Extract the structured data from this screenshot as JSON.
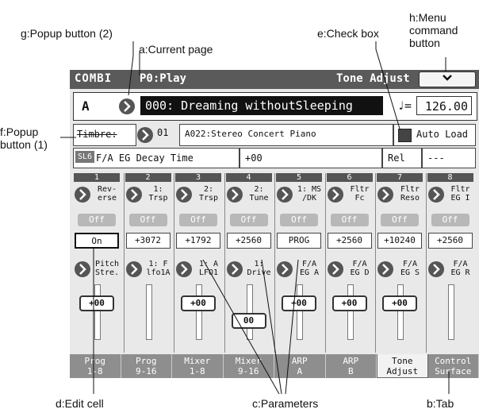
{
  "annotations": {
    "g": "g:Popup button (2)",
    "a": "a:Current page",
    "e": "e:Check box",
    "h_line1": "h:Menu",
    "h_line2": "command",
    "h_line3": "button",
    "f_line1": "f:Popup",
    "f_line2": "button (1)",
    "d": "d:Edit cell",
    "c": "c:Parameters",
    "b": "b:Tab"
  },
  "titlebar": {
    "mode": "COMBI",
    "page": "P0:Play",
    "subpage": "Tone Adjust",
    "menu_icon": "chevron-down-icon",
    "menu_glyph": "⌄"
  },
  "program": {
    "bank": "A",
    "name": "000: Dreaming withoutSleeping",
    "tempo_symbol": "♩=",
    "tempo": "126.00"
  },
  "timbre": {
    "label": "Timbre:",
    "number": "01",
    "program": "A022:Stereo Concert Piano",
    "autoload_label": "Auto Load"
  },
  "param": {
    "slot": "SL6",
    "name": "F/A EG Decay Time",
    "value": "+00",
    "rel_label": "Rel",
    "rel_value": "---"
  },
  "channels": [
    {
      "num": "1",
      "name1": "Rev-\nerse",
      "off": "Off",
      "value": "On",
      "name2": "Pitch\nStre.",
      "knob": "+00"
    },
    {
      "num": "2",
      "name1": "1:\nTrsp",
      "off": "Off",
      "value": "+3072",
      "name2": "1: F\nlfo1A",
      "knob": ""
    },
    {
      "num": "3",
      "name1": "2:\nTrsp",
      "off": "Off",
      "value": "+1792",
      "name2": "1: A\nLFO1",
      "knob": "+00"
    },
    {
      "num": "4",
      "name1": "2:\nTune",
      "off": "Off",
      "value": "+2560",
      "name2": "1:\nDrive",
      "knob": "00"
    },
    {
      "num": "5",
      "name1": "1: MS\n/DK",
      "off": "Off",
      "value": "PROG",
      "name2": "F/A\nEG A",
      "knob": "+00"
    },
    {
      "num": "6",
      "name1": "Fltr\nFc",
      "off": "Off",
      "value": "+2560",
      "name2": "F/A\nEG D",
      "knob": "+00"
    },
    {
      "num": "7",
      "name1": "Fltr\nReso",
      "off": "Off",
      "value": "+10240",
      "name2": "F/A\nEG S",
      "knob": "+00"
    },
    {
      "num": "8",
      "name1": "Fltr\nEG I",
      "off": "Off",
      "value": "+2560",
      "name2": "F/A\nEG R",
      "knob": ""
    }
  ],
  "tabs": [
    {
      "line1": "Prog",
      "line2": "1-8"
    },
    {
      "line1": "Prog",
      "line2": "9-16"
    },
    {
      "line1": "Mixer",
      "line2": "1-8"
    },
    {
      "line1": "Mixer",
      "line2": "9-16"
    },
    {
      "line1": "ARP",
      "line2": "A"
    },
    {
      "line1": "ARP",
      "line2": "B"
    },
    {
      "line1": "Tone",
      "line2": "Adjust"
    },
    {
      "line1": "Control",
      "line2": "Surface"
    }
  ],
  "active_tab": "Tone Adjust"
}
